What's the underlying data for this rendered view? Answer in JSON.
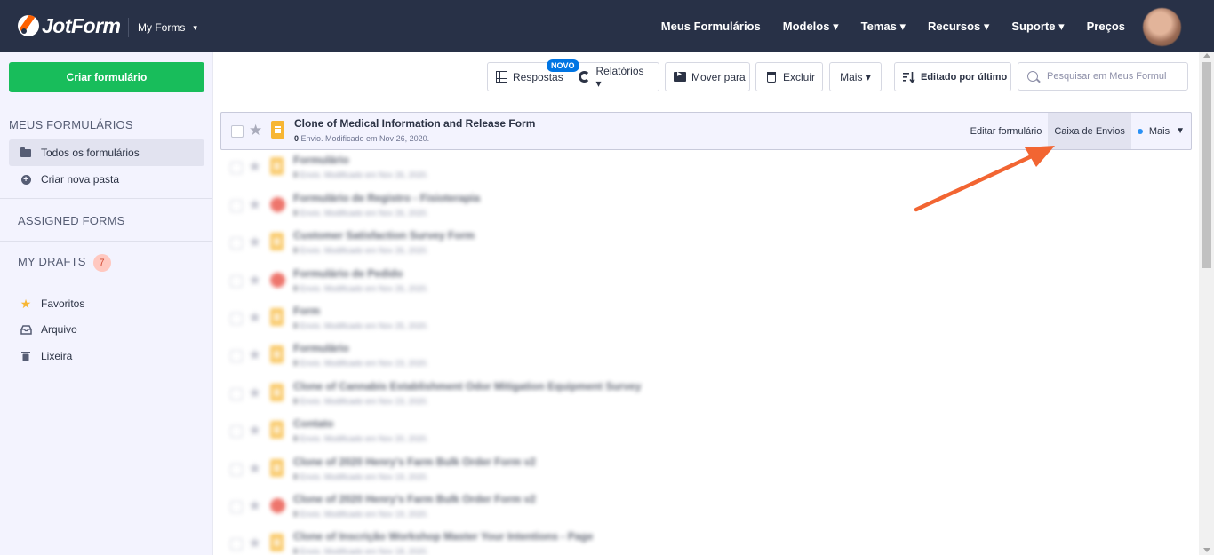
{
  "header": {
    "logo_text": "JotForm",
    "my_forms_label": "My Forms",
    "nav": [
      "Meus Formulários",
      "Modelos ▾",
      "Temas ▾",
      "Recursos ▾",
      "Suporte ▾",
      "Preços"
    ]
  },
  "sidebar": {
    "create_button": "Criar formulário",
    "section_my_forms": "MEUS FORMULÁRIOS",
    "all_forms": "Todos os formulários",
    "new_folder": "Criar nova pasta",
    "assigned_forms": "ASSIGNED FORMS",
    "my_drafts": "MY DRAFTS",
    "drafts_count": "7",
    "favorites": "Favoritos",
    "archive": "Arquivo",
    "trash": "Lixeira"
  },
  "toolbar": {
    "responses": "Respostas",
    "new_badge": "NOVO",
    "reports": "Relatórios ▾",
    "move_to": "Mover para",
    "delete": "Excluir",
    "more": "Mais ▾",
    "sort": "Editado por último",
    "search_placeholder": "Pesquisar em Meus Formul"
  },
  "forms": [
    {
      "title": "Clone of Medical Information and Release Form",
      "submissions": "0",
      "meta": " Envio. Modificado em Nov 26, 2020.",
      "icon": "doc"
    },
    {
      "title": "Formulário",
      "submissions": "0",
      "meta": " Envio. Modificado em Nov 26, 2020.",
      "icon": "doc"
    },
    {
      "title": "Formulário de Registro - Fisioterapia",
      "submissions": "0",
      "meta": " Envio. Modificado em Nov 26, 2020.",
      "icon": "red"
    },
    {
      "title": "Customer Satisfaction Survey Form",
      "submissions": "0",
      "meta": " Envio. Modificado em Nov 26, 2020.",
      "icon": "doc"
    },
    {
      "title": "Formulário de Pedido",
      "submissions": "0",
      "meta": " Envio. Modificado em Nov 26, 2020.",
      "icon": "red"
    },
    {
      "title": "Form",
      "submissions": "0",
      "meta": " Envio. Modificado em Nov 25, 2020.",
      "icon": "doc"
    },
    {
      "title": "Formulário",
      "submissions": "0",
      "meta": " Envio. Modificado em Nov 23, 2020.",
      "icon": "doc"
    },
    {
      "title": "Clone of Cannabis Establishment Odor Mitigation Equipment Survey",
      "submissions": "0",
      "meta": " Envio. Modificado em Nov 23, 2020.",
      "icon": "doc"
    },
    {
      "title": "Contato",
      "submissions": "0",
      "meta": " Envio. Modificado em Nov 20, 2020.",
      "icon": "doc"
    },
    {
      "title": "Clone of 2020 Henry's Farm Bulk Order Form v2",
      "submissions": "0",
      "meta": " Envio. Modificado em Nov 19, 2020.",
      "icon": "doc"
    },
    {
      "title": "Clone of 2020 Henry's Farm Bulk Order Form v2",
      "submissions": "0",
      "meta": " Envio. Modificado em Nov 19, 2020.",
      "icon": "red"
    },
    {
      "title": "Clone of Inscrição Workshop Master Your Intentions - Page",
      "submissions": "0",
      "meta": " Envio. Modificado em Nov 18, 2020.",
      "icon": "doc"
    }
  ],
  "row_actions": {
    "edit": "Editar formulário",
    "inbox": "Caixa de Envios",
    "more": "Mais"
  },
  "colors": {
    "header_bg": "#283147",
    "create_button": "#18bd5b",
    "arrow": "#f26532",
    "new_badge": "#0075e3"
  }
}
